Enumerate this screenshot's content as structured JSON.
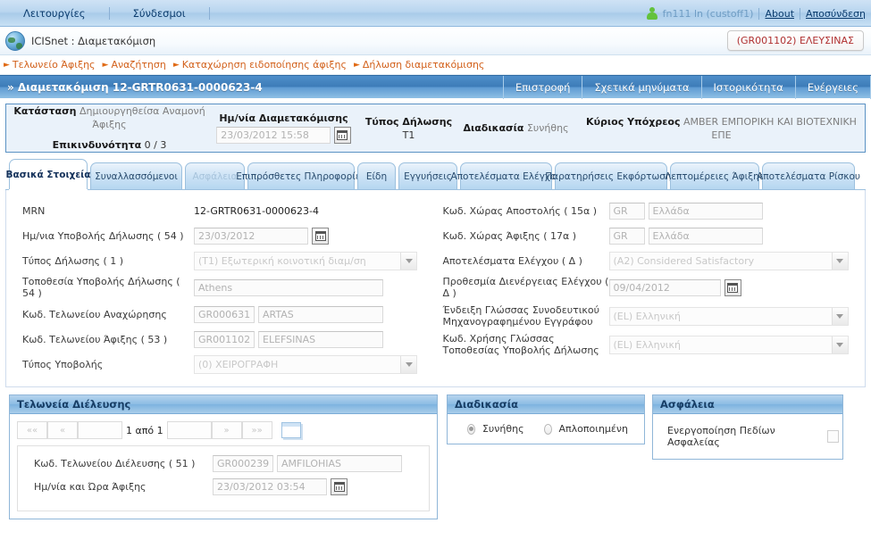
{
  "topbar": {
    "menu": [
      {
        "label": "Λειτουργίες"
      },
      {
        "label": "Σύνδεσμοι"
      }
    ],
    "user": "fn111 ln (custoff1)",
    "about_label": "About",
    "logout_label": "Αποσύνδεση"
  },
  "app": {
    "title": "ICISnet : Διαμετακόμιση",
    "office_badge": "(GR001102) ΕΛΕΥΣΙΝΑΣ"
  },
  "breadcrumb": [
    {
      "label": "Τελωνείο Άφιξης"
    },
    {
      "label": "Αναζήτηση"
    },
    {
      "label": "Καταχώρηση ειδοποίησης άφιξης"
    },
    {
      "label": "Δήλωση διαμετακόμισης"
    }
  ],
  "pagebar": {
    "title": "» Διαμετακόμιση 12-GRTR0631-0000623-4",
    "actions": [
      {
        "label": "Επιστροφή"
      },
      {
        "label": "Σχετικά μηνύματα"
      },
      {
        "label": "Ιστορικότητα"
      },
      {
        "label": "Ενέργειες"
      }
    ]
  },
  "status_panel": {
    "katastasi_label": "Κατάσταση",
    "katastasi_value": "Δημιουργηθείσα Αναμονή Άφιξης",
    "risk_label": "Επικινδυνότητα",
    "risk_value": "0 / 3",
    "date_header": "Ημ/νία Διαμετακόμισης",
    "date_value": "23/03/2012 15:58",
    "type_label": "Τύπος Δήλωσης",
    "type_value": "T1",
    "procedure_label": "Διαδικασία",
    "procedure_value": "Συνήθης",
    "principal_label": "Κύριος Υπόχρεος",
    "principal_value": "AMBER ΕΜΠΟΡΙΚΗ ΚΑΙ ΒΙΟΤΕΧΝΙΚΗ ΕΠΕ"
  },
  "tabs": [
    {
      "label": "Βασικά Στοιχεία",
      "state": "active"
    },
    {
      "label": "Συναλλασσόμενοι",
      "state": "normal"
    },
    {
      "label": "Ασφάλεια",
      "state": "disabled"
    },
    {
      "label": "Επιπρόσθετες Πληροφορίες",
      "state": "normal"
    },
    {
      "label": "Είδη",
      "state": "normal"
    },
    {
      "label": "Εγγυήσεις",
      "state": "normal"
    },
    {
      "label": "Αποτελέσματα Ελέγχου",
      "state": "normal"
    },
    {
      "label": "Παρατηρήσεις Εκφόρτωσης",
      "state": "normal"
    },
    {
      "label": "Λεπτομέρειες Άφιξης",
      "state": "normal"
    },
    {
      "label": "Αποτελέσματα Ρίσκου",
      "state": "normal"
    }
  ],
  "form_left": {
    "mrn_label": "MRN",
    "mrn_value": "12-GRTR0631-0000623-4",
    "submit_date_label": "Ημ/νια Υποβολής Δήλωσης ( 54 )",
    "submit_date_value": "23/03/2012",
    "decl_type_label": "Τύπος Δήλωσης ( 1 )",
    "decl_type_value": "(T1) Εξωτερική κοινοτική διαμ/ση",
    "location_label": "Τοποθεσία Υποβολής Δήλωσης ( 54 )",
    "location_value": "Athens",
    "departure_office_label": "Κωδ. Τελωνείου Αναχώρησης",
    "departure_office_code": "GR000631",
    "departure_office_name": "ARTAS",
    "arrival_office_label": "Κωδ. Τελωνείου Άφιξης ( 53 )",
    "arrival_office_code": "GR001102",
    "arrival_office_name": "ELEFSINAS",
    "submit_type_label": "Τύπος Υποβολής",
    "submit_type_value": "(0) ΧΕΙΡΟΓΡΑΦΗ"
  },
  "form_right": {
    "dispatch_country_label": "Κωδ. Χώρας Αποστολής ( 15α )",
    "dispatch_country_code": "GR",
    "dispatch_country_name": "Ελλάδα",
    "arrival_country_label": "Κωδ. Χώρας Άφιξης ( 17α )",
    "arrival_country_code": "GR",
    "arrival_country_name": "Ελλάδα",
    "control_results_label": "Αποτελέσματα Ελέγχου ( Δ )",
    "control_results_value": "(A2) Considered Satisfactory",
    "control_deadline_label": "Προθεσμία Διενέργειας Ελέγχου ( Δ )",
    "control_deadline_value": "09/04/2012",
    "doc_language_label": "Ένδειξη Γλώσσας Συνοδευτικού Μηχανογραφημένου Εγγράφου",
    "doc_language_value": "(EL) Ελληνική",
    "location_language_label": "Κωδ. Χρήσης Γλώσσας Τοποθεσίας Υποβολής Δήλωσης",
    "location_language_value": "(EL) Ελληνική"
  },
  "transit_panel": {
    "title": "Τελωνεία Διέλευσης",
    "pager": {
      "first": "««",
      "prev": "«",
      "label": "1 από 1",
      "next": "»",
      "last": "»»"
    },
    "office_code_label": "Κωδ. Τελωνείου Διέλευσης ( 51 )",
    "office_code": "GR000239",
    "office_name": "AMFILOHIAS",
    "arrival_datetime_label": "Ημ/νία και Ώρα Άφιξης",
    "arrival_datetime_value": "23/03/2012 03:54"
  },
  "procedure_panel": {
    "title": "Διαδικασία",
    "option_normal": "Συνήθης",
    "option_simplified": "Απλοποιημένη",
    "selected": "normal"
  },
  "security_panel": {
    "title": "Ασφάλεια",
    "checkbox_label": "Ενεργοποίηση Πεδίων Ασφαλείας",
    "checked": false
  },
  "colors": {
    "accent_blue": "#3d7cb8",
    "panel_header": "#8cbce4",
    "breadcrumb_orange": "#d2601a",
    "badge_red": "#b03030",
    "status_border": "#5b92c4"
  }
}
